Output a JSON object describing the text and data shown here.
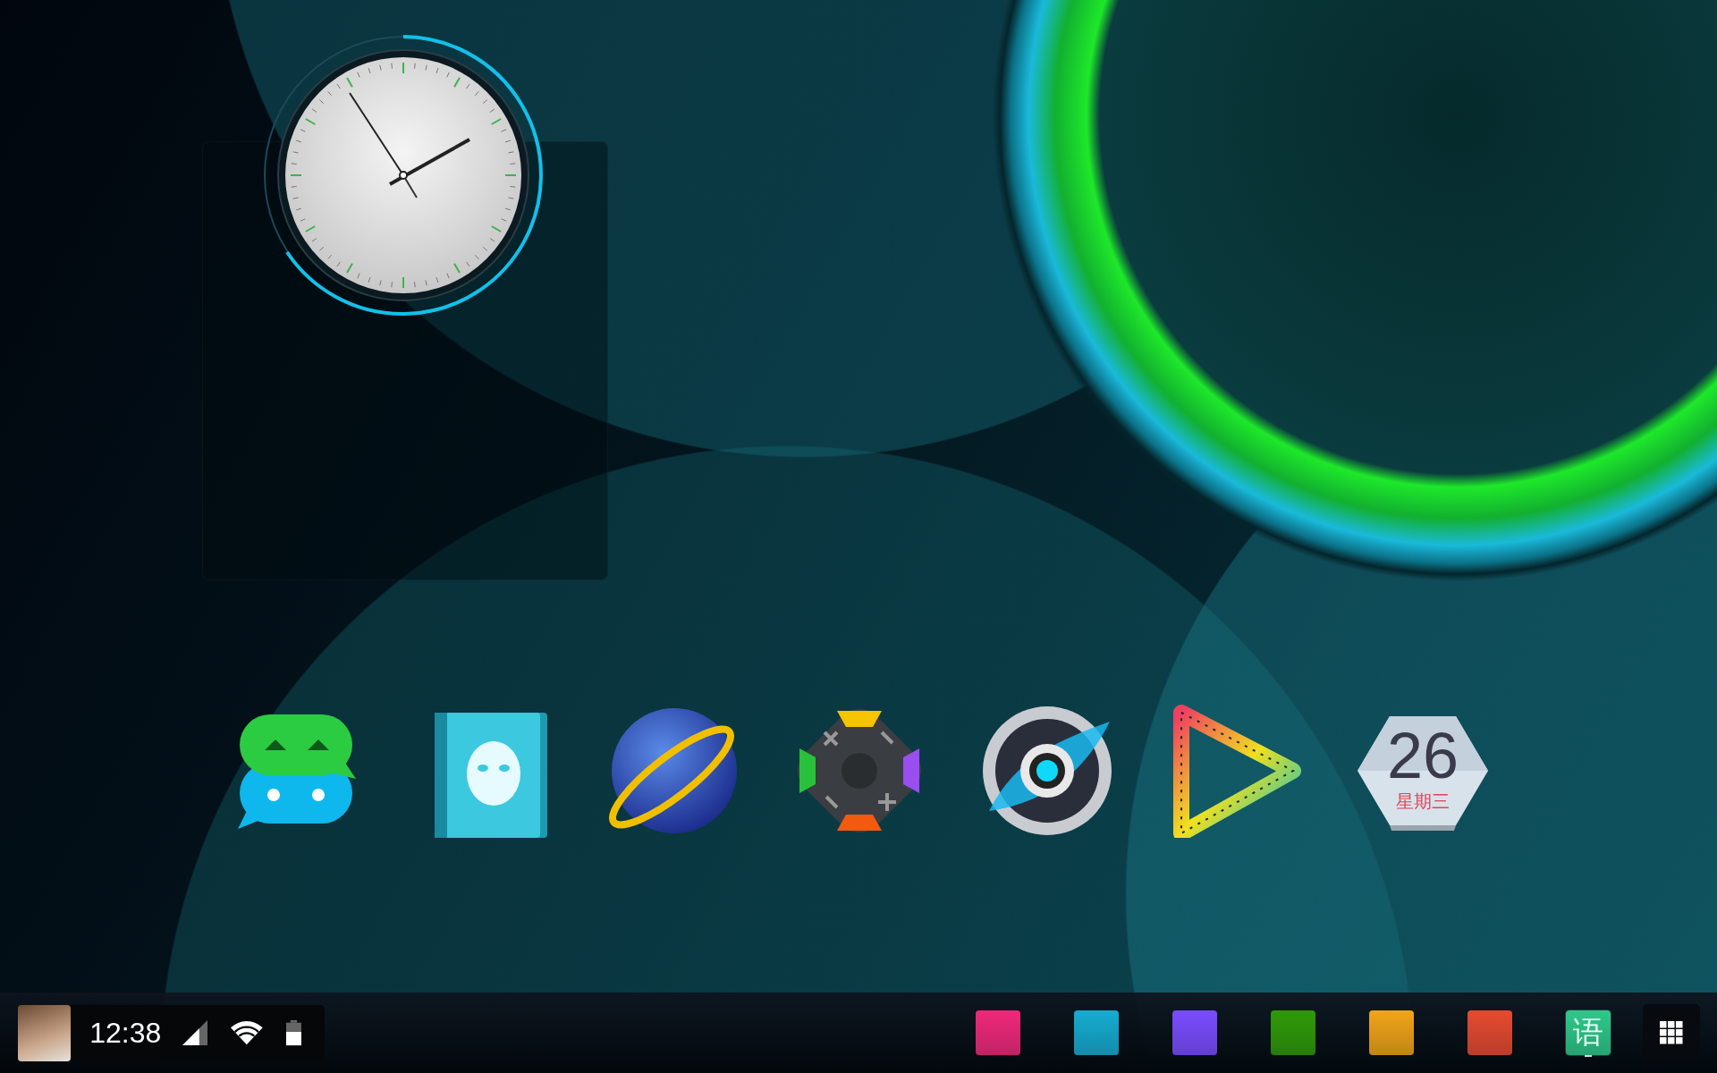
{
  "desktop_icons": [
    {
      "kind": "chat"
    },
    {
      "kind": "contacts"
    },
    {
      "kind": "browser"
    },
    {
      "kind": "game"
    },
    {
      "kind": "camera"
    },
    {
      "kind": "video"
    },
    {
      "kind": "calendar",
      "day": "26",
      "weekday": "星期三"
    }
  ],
  "status_panel": {
    "time": "12:38"
  },
  "dock": [
    {
      "color": "#f0287a",
      "selected": false
    },
    {
      "color": "#16acd0",
      "selected": false
    },
    {
      "color": "#7a4cff",
      "selected": false
    },
    {
      "color": "#2f9a08",
      "selected": false
    },
    {
      "color": "#f0a418",
      "selected": false
    },
    {
      "color": "#e64a30",
      "selected": false
    },
    {
      "color": "#2ec98a",
      "label": "语",
      "selected": true
    }
  ]
}
